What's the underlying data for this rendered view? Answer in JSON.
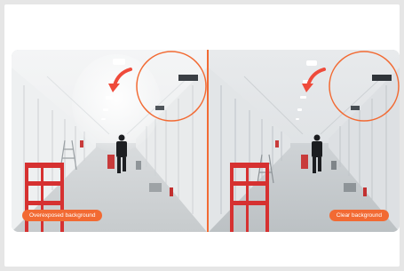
{
  "comparison": {
    "left": {
      "label": "Overexposed background"
    },
    "right": {
      "label": "Clear background"
    }
  },
  "colors": {
    "accent": "#f26a33",
    "page_background": "#e6e6e6",
    "frame": "#ffffff"
  },
  "icons": {
    "arrow": "curved-arrow-icon",
    "highlight": "highlight-circle"
  }
}
